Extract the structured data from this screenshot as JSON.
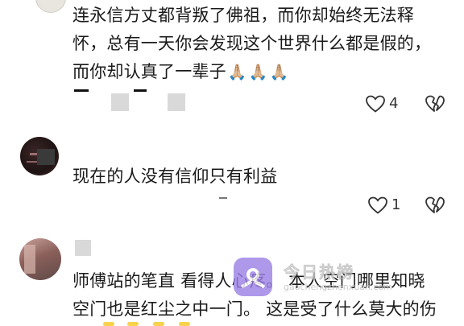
{
  "comments": [
    {
      "line1": "连永信方丈都背叛了佛祖，而你却始终无法释",
      "line2": "怀，总有一天你会发现这个世界什么都是假的，",
      "line3": "而你却认真了一辈子",
      "emojis": [
        "🙏🏼",
        "🙏🏼",
        "🙏🏼"
      ],
      "like_count": "4"
    },
    {
      "text": "现在的人没有信仰只有利益",
      "like_count": "1"
    },
    {
      "line1": "师傅站的笔直 看得人心疼。 本人空门哪里知晓",
      "line2": "空门也是红尘之中一门。 这是受了什么莫大的伤"
    }
  ],
  "watermark": {
    "title": "今日热榜",
    "url": "gaochengzhenxuan.com"
  },
  "colors": {
    "icon": "#333333",
    "mask": "#d9d9d9",
    "watermark_logo": "#9b7fe6"
  }
}
